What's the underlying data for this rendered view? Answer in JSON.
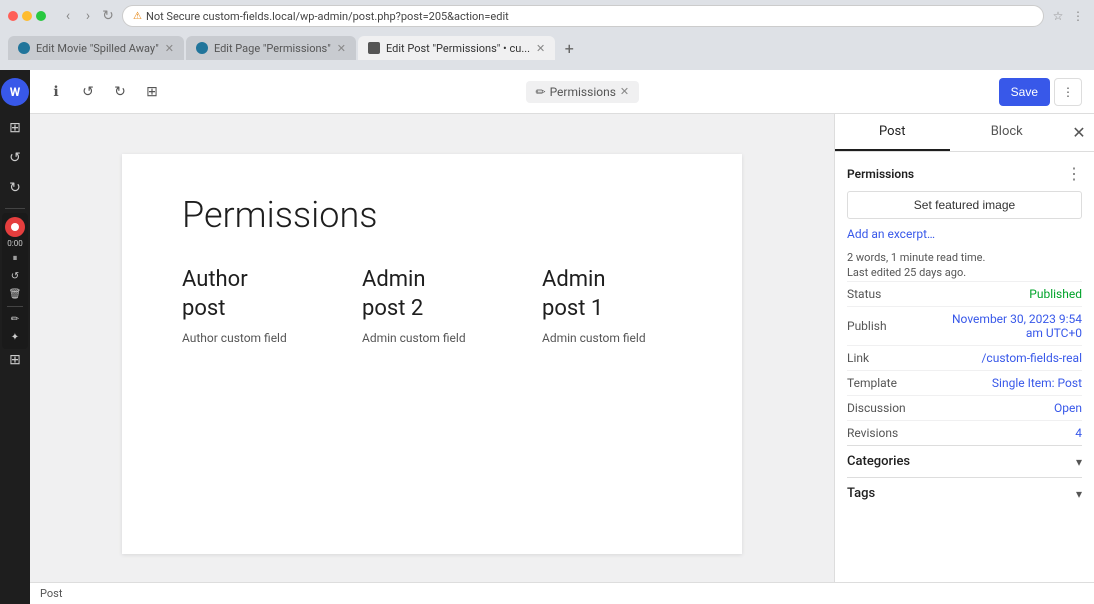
{
  "browser": {
    "tabs": [
      {
        "id": "tab1",
        "label": "Edit Movie \"Spilled Away\"",
        "favicon": "wp",
        "active": false
      },
      {
        "id": "tab2",
        "label": "Edit Page \"Permissions\"",
        "favicon": "wp",
        "active": false
      },
      {
        "id": "tab3",
        "label": "Edit Post \"Permissions\" • cu...",
        "favicon": "active-tab",
        "active": true
      }
    ],
    "address": "Not Secure  custom-fields.local/wp-admin/post.php?post=205&action=edit",
    "lock_label": "Not Secure"
  },
  "editor": {
    "tabs": [
      {
        "id": "permissions-tab",
        "label": "Permissions",
        "icon": "✏",
        "active": true
      }
    ],
    "save_label": "Save",
    "settings_icon": "⋮",
    "nav": {
      "undo_label": "↺",
      "redo_label": "↻",
      "tools_label": "⊞",
      "details_label": "ℹ"
    }
  },
  "page": {
    "title": "Permissions",
    "posts": [
      {
        "id": "author-post",
        "title": "Author post",
        "custom_field": "Author custom field"
      },
      {
        "id": "admin-post-2",
        "title": "Admin post 2",
        "custom_field": "Admin custom field"
      },
      {
        "id": "admin-post-1",
        "title": "Admin post 1",
        "custom_field": "Admin custom field"
      }
    ]
  },
  "sidebar": {
    "tab_post": "Post",
    "tab_block": "Block",
    "sections": {
      "permissions_label": "Permissions",
      "featured_image_btn": "Set featured image",
      "add_excerpt": "Add an excerpt…",
      "meta_words": "2 words, 1 minute read time.",
      "meta_edited": "Last edited 25 days ago.",
      "status_label": "Status",
      "status_value": "Published",
      "publish_label": "Publish",
      "publish_value": "November 30, 2023 9:54 am UTC+0",
      "link_label": "Link",
      "link_value": "/custom-fields-real",
      "template_label": "Template",
      "template_value": "Single Item: Post",
      "discussion_label": "Discussion",
      "discussion_value": "Open",
      "revisions_label": "Revisions",
      "revisions_value": "4",
      "categories_label": "Categories",
      "tags_label": "Tags"
    }
  },
  "status_bar": {
    "text": "Post"
  },
  "recording": {
    "time": "0:00"
  }
}
